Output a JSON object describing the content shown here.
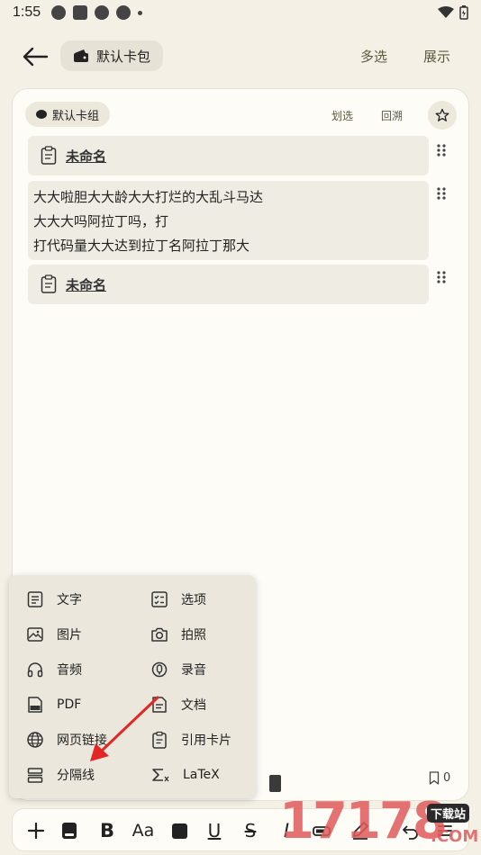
{
  "status": {
    "time": "1:55"
  },
  "app_bar": {
    "pack_name": "默认卡包",
    "multi_select": "多选",
    "show": "展示"
  },
  "card": {
    "group_name": "默认卡组",
    "scribe": "划选",
    "trace": "回溯",
    "blocks": [
      {
        "type": "ref",
        "title": "未命名"
      },
      {
        "type": "text",
        "lines": [
          "大大啦胆大大龄大大打烂的大乱斗马达",
          "大大大吗阿拉丁吗，打",
          "打代码量大大达到拉丁名阿拉丁那大"
        ]
      },
      {
        "type": "ref",
        "title": "未命名"
      }
    ],
    "bookmark_count": "0"
  },
  "insert_menu": {
    "items": [
      {
        "label": "文字",
        "icon": "text-doc-icon"
      },
      {
        "label": "选项",
        "icon": "checklist-icon"
      },
      {
        "label": "图片",
        "icon": "image-icon"
      },
      {
        "label": "拍照",
        "icon": "camera-icon"
      },
      {
        "label": "音频",
        "icon": "headphones-icon"
      },
      {
        "label": "录音",
        "icon": "microphone-icon"
      },
      {
        "label": "PDF",
        "icon": "pdf-icon"
      },
      {
        "label": "文档",
        "icon": "document-icon"
      },
      {
        "label": "网页链接",
        "icon": "globe-icon"
      },
      {
        "label": "引用卡片",
        "icon": "card-ref-icon"
      },
      {
        "label": "分隔线",
        "icon": "divider-icon"
      },
      {
        "label": "LaTeX",
        "icon": "sigma-icon"
      }
    ]
  },
  "toolbar": {
    "bold": "B",
    "font_size": "Aa",
    "underline": "U",
    "strike": "S",
    "italic": "I"
  },
  "watermark": {
    "text": "17178",
    "badge": "下载站",
    "suffix": ".COM"
  }
}
